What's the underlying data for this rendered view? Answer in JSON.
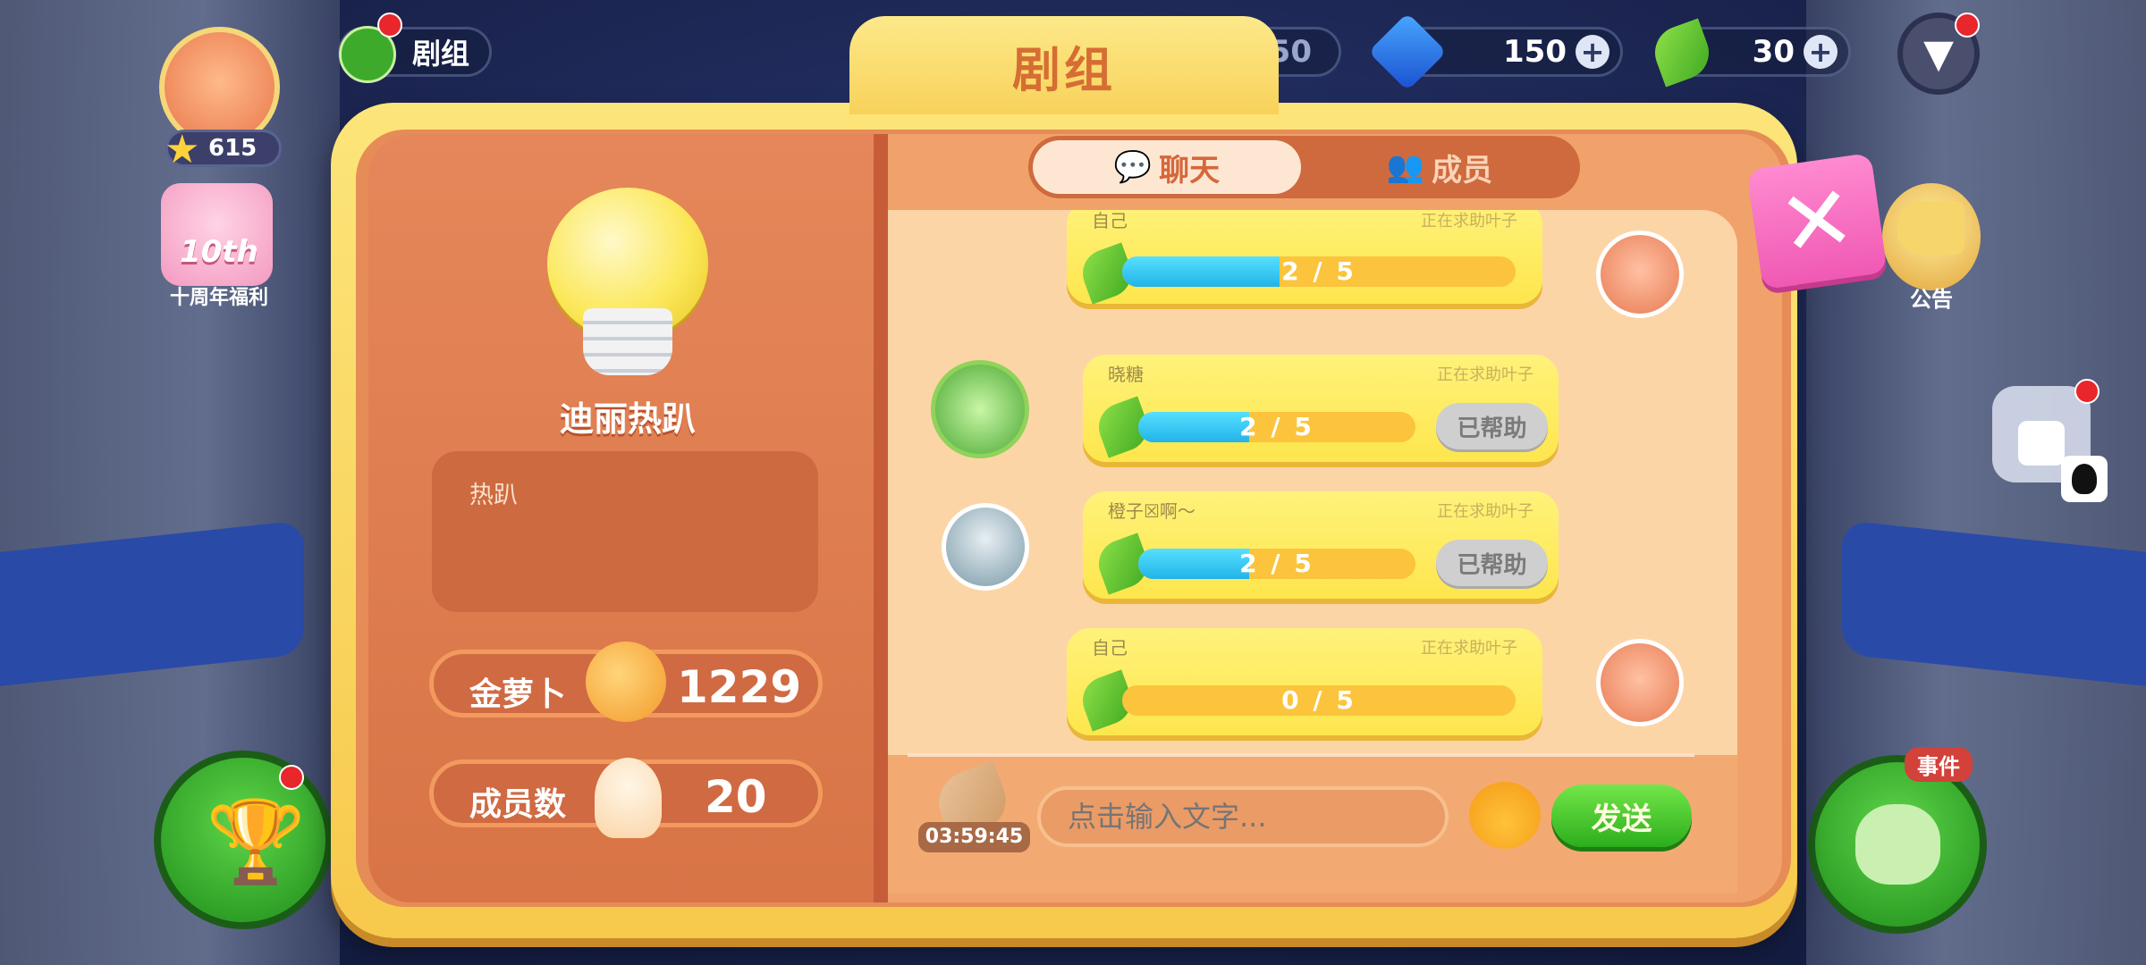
{
  "hud": {
    "player_stars": "615",
    "group_button_label": "剧组",
    "currency_1": "50",
    "gems": "150",
    "leaves": "30",
    "anniversary_label": "十周年福利",
    "anniversary_badge": "10th",
    "announcement_label": "公告",
    "event_badge": "事件"
  },
  "modal": {
    "title": "剧组",
    "group_name": "迪丽热趴",
    "group_desc": "热趴",
    "gold_carrot_label": "金萝卜",
    "gold_carrot_value": "1229",
    "member_count_label": "成员数",
    "member_count_value": "20",
    "tabs": {
      "chat": "聊天",
      "members": "成员"
    },
    "chat": [
      {
        "name": "自己",
        "status": "正在求助叶子",
        "progress_text": "2 / 5",
        "progress": 0.4,
        "side": "right",
        "helped": false
      },
      {
        "name": "晓糖",
        "status": "正在求助叶子",
        "progress_text": "2 / 5",
        "progress": 0.4,
        "side": "left",
        "helped": true,
        "helped_label": "已帮助"
      },
      {
        "name": "橙子☒啊～",
        "status": "正在求助叶子",
        "progress_text": "2 / 5",
        "progress": 0.4,
        "side": "left",
        "helped": true,
        "helped_label": "已帮助"
      },
      {
        "name": "自己",
        "status": "正在求助叶子",
        "progress_text": "0 / 5",
        "progress": 0.0,
        "side": "right",
        "helped": false
      }
    ],
    "timer": "03:59:45",
    "input_placeholder": "点击输入文字...",
    "send_label": "发送",
    "close_label": "✕"
  },
  "colors": {
    "accent_orange": "#d6673a",
    "progress_blue": "#22b4e8",
    "leaf_green": "#3fa820",
    "close_pink": "#f059b4"
  }
}
